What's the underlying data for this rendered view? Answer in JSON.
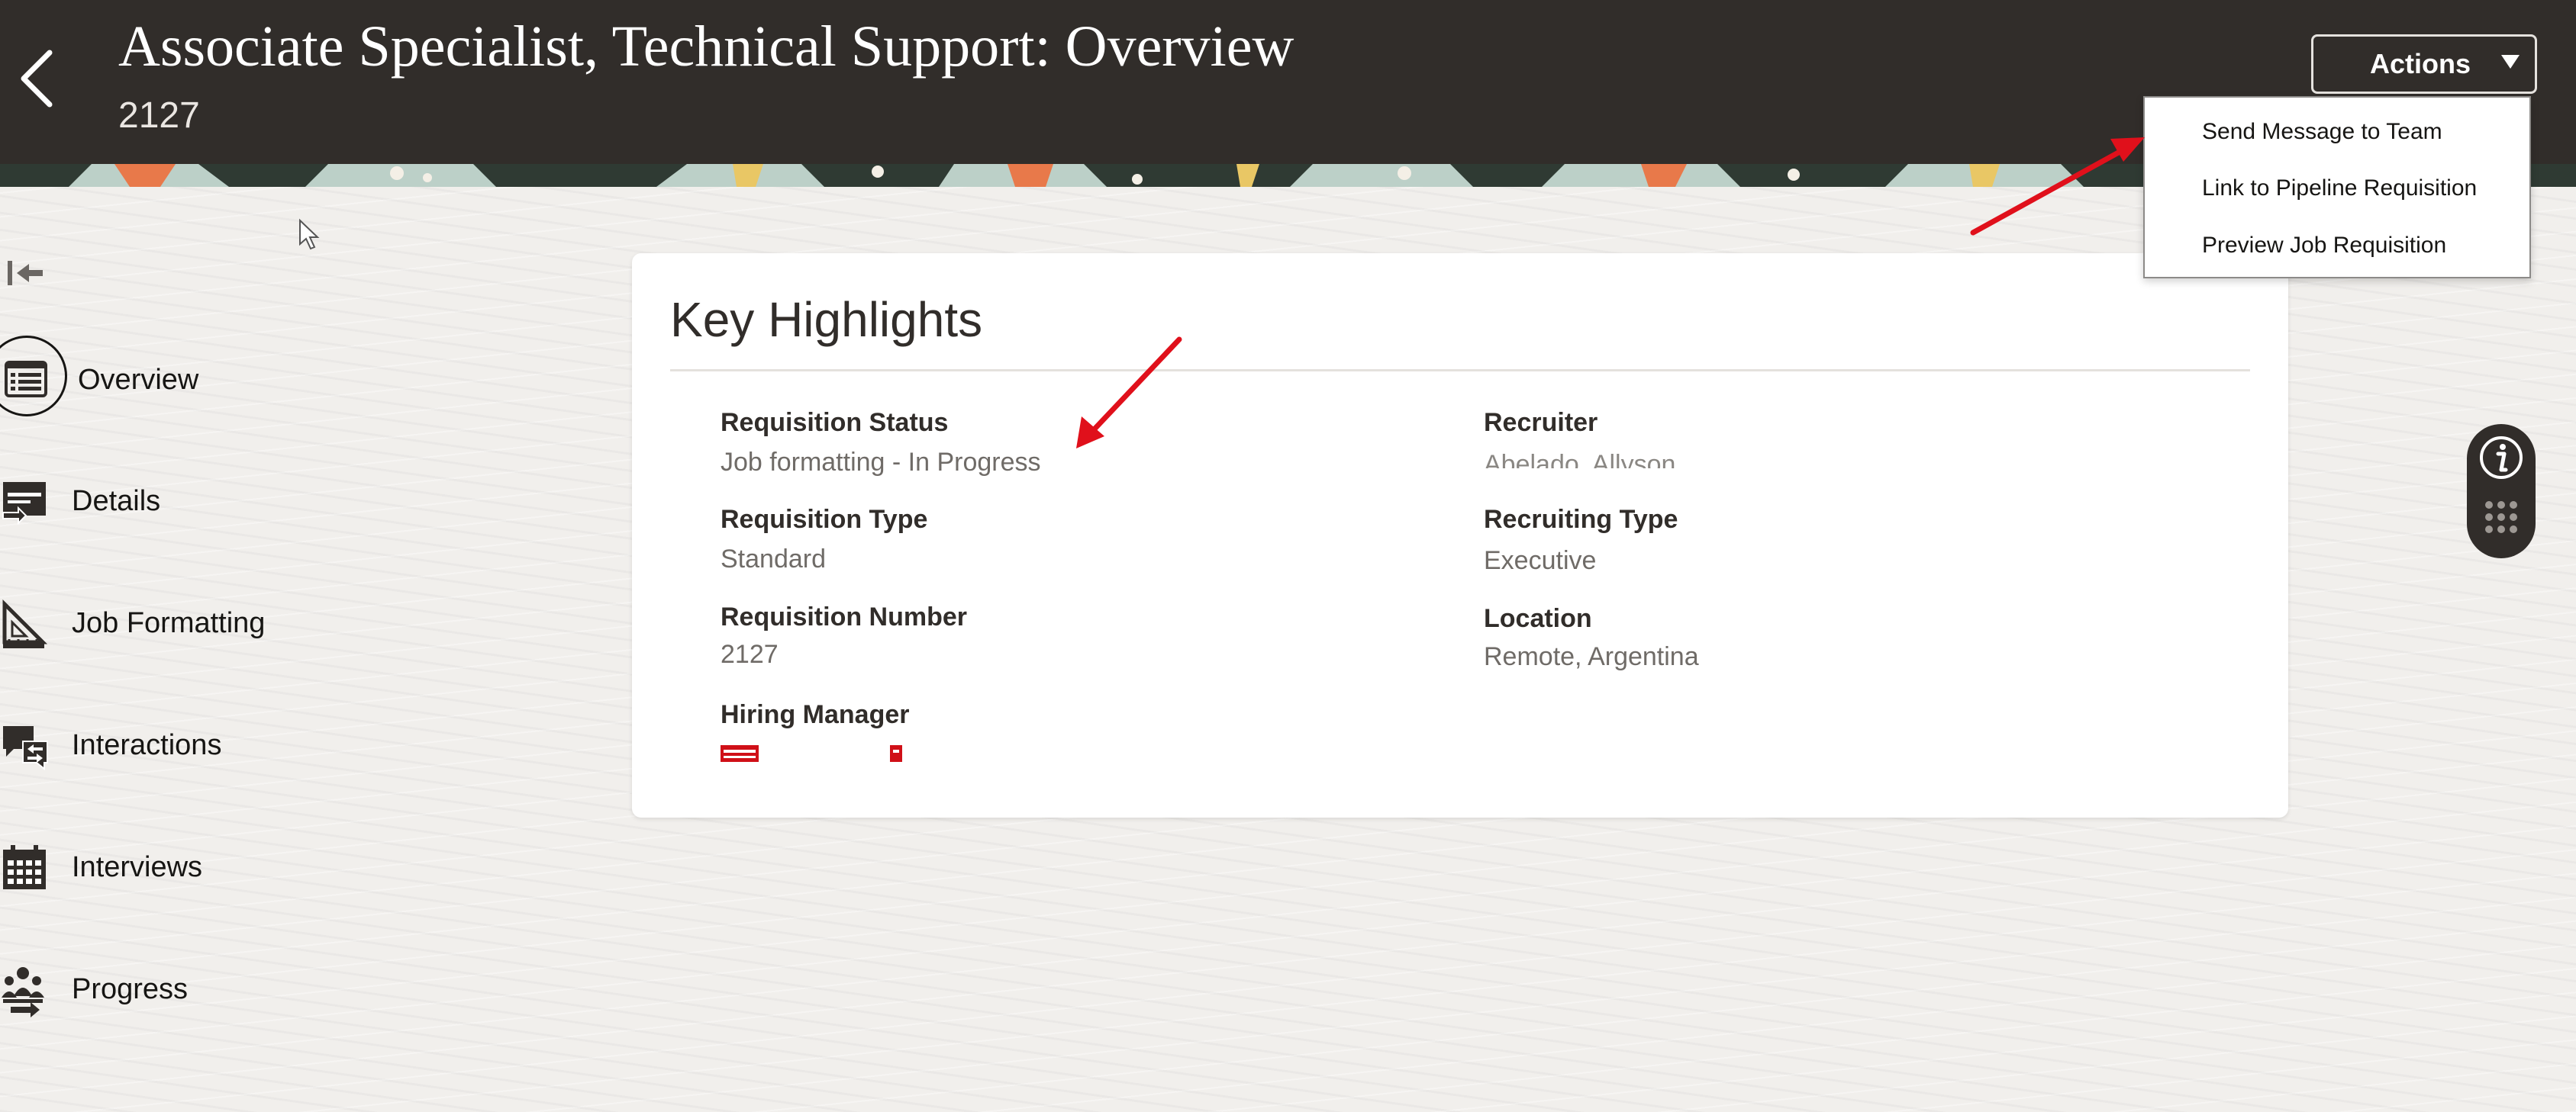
{
  "header": {
    "title": "Associate Specialist, Technical Support: Overview",
    "subtitle": "2127",
    "back_icon": "chevron-left-icon",
    "actions_label": "Actions"
  },
  "actions_menu": {
    "items": [
      {
        "label": "Send Message to Team"
      },
      {
        "label": "Link to Pipeline Requisition"
      },
      {
        "label": "Preview Job Requisition"
      }
    ]
  },
  "sidebar": {
    "collapse_icon": "collapse-left-icon",
    "items": [
      {
        "label": "Overview",
        "icon": "list-icon",
        "selected": true
      },
      {
        "label": "Details",
        "icon": "details-icon"
      },
      {
        "label": "Job Formatting",
        "icon": "ruler-icon"
      },
      {
        "label": "Interactions",
        "icon": "chat-icon"
      },
      {
        "label": "Interviews",
        "icon": "calendar-icon"
      },
      {
        "label": "Progress",
        "icon": "people-icon"
      }
    ]
  },
  "key_highlights": {
    "title": "Key Highlights",
    "left": [
      {
        "label": "Requisition Status",
        "value": "Job formatting - In Progress"
      },
      {
        "label": "Requisition Type",
        "value": "Standard"
      },
      {
        "label": "Requisition Number",
        "value": "2127"
      },
      {
        "label": "Hiring Manager",
        "value": ""
      }
    ],
    "right": [
      {
        "label": "Recruiter",
        "value": "Abelado, Allyson"
      },
      {
        "label": "Recruiting Type",
        "value": "Executive"
      },
      {
        "label": "Location",
        "value": "Remote, Argentina"
      }
    ]
  },
  "help_widget": {
    "info_icon": "info-icon",
    "grid_icon": "grid-dots-icon"
  },
  "colors": {
    "header_bg": "#312d2a",
    "annotation_red": "#e0101b",
    "page_bg": "#f1efec"
  }
}
